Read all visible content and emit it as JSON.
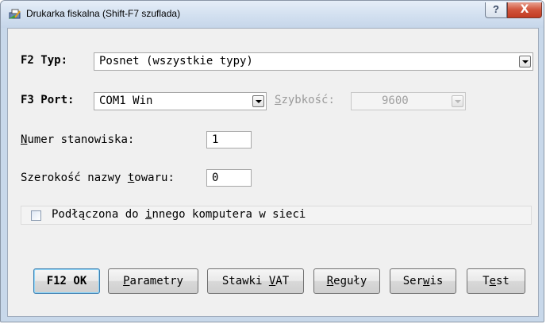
{
  "window": {
    "title": "Drukarka fiskalna  (Shift-F7 szuflada)",
    "help_label": "?",
    "close_label": "X"
  },
  "form": {
    "typ_label_key": "F2 ",
    "typ_label_rest": "Typ:",
    "typ_value": "Posnet (wszystkie typy)",
    "port_label_key": "F3 ",
    "port_label_rest": "Port:",
    "port_value": "COM1 Win",
    "speed_label_ul": "S",
    "speed_label_rest": "zybkość:",
    "speed_value": "9600",
    "station_label_ul": "N",
    "station_label_rest": "umer stanowiska:",
    "station_value": "1",
    "width_label_pre": "Szerokość nazwy ",
    "width_label_ul": "t",
    "width_label_rest": "owaru:",
    "width_value": "0",
    "network_pre": "Podłączona do ",
    "network_ul": "i",
    "network_rest": "nnego komputera w sieci",
    "network_checked": false
  },
  "buttons": {
    "ok_label": "F12 OK",
    "params_ul": "P",
    "params_rest": "arametry",
    "vat_pre": "Stawki ",
    "vat_ul": "V",
    "vat_rest": "AT",
    "rules_ul": "R",
    "rules_rest": "eguły",
    "service_pre": "Ser",
    "service_ul": "w",
    "service_rest": "is",
    "test_pre": "T",
    "test_ul": "e",
    "test_rest": "st"
  }
}
